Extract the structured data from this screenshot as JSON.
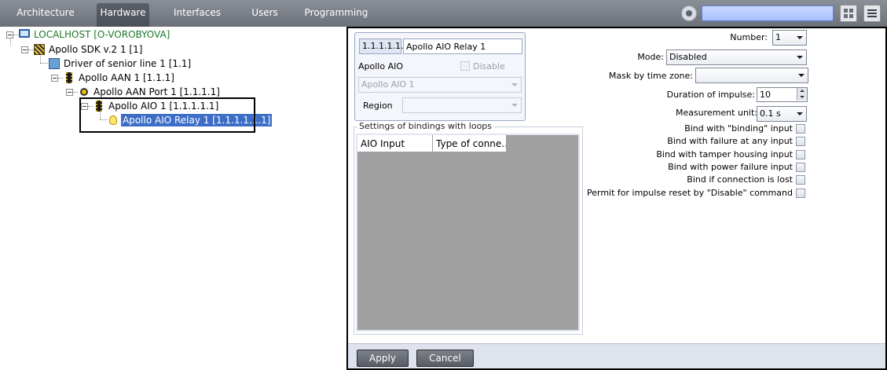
{
  "tabs": [
    {
      "label": "Architecture"
    },
    {
      "label": "Hardware"
    },
    {
      "label": "Interfaces"
    },
    {
      "label": "Users"
    },
    {
      "label": "Programming"
    }
  ],
  "active_tab": "Hardware",
  "tree": {
    "nodes": [
      {
        "label": "LOCALHOST [O-VOROBYOVA]",
        "icon": "computer-icon"
      },
      {
        "label": "Apollo SDK v.2 1 [1]",
        "icon": "sdk-icon"
      },
      {
        "label": "Driver of senior line 1 [1.1]",
        "icon": "driver-icon"
      },
      {
        "label": "Apollo AAN 1 [1.1.1]",
        "icon": "chip-icon"
      },
      {
        "label": "Apollo AAN Port 1 [1.1.1.1]",
        "icon": "port-icon"
      },
      {
        "label": "Apollo AIO 1 [1.1.1.1.1]",
        "icon": "chip-icon"
      },
      {
        "label": "Apollo AIO Relay 1 [1.1.1.1.1.1]",
        "icon": "bulb-icon"
      }
    ]
  },
  "object": {
    "number_prefix": "1.1.1.1.1.",
    "name": "Apollo AIO Relay 1",
    "parent_label": "Apollo AIO",
    "disable_label": "Disable",
    "parent_value": "Apollo AIO 1",
    "region_label": "Region",
    "region_value": ""
  },
  "bindings": {
    "title": "Settings of bindings with loops",
    "columns": [
      "AIO Input",
      "Type of conne..."
    ]
  },
  "settings": {
    "number_label": "Number:",
    "number_value": "1",
    "mode_label": "Mode:",
    "mode_value": "Disabled",
    "mask_label": "Mask by time zone:",
    "mask_value": "",
    "duration_label": "Duration of impulse:",
    "duration_value": "10",
    "unit_label": "Measurement unit:",
    "unit_value": "0.1 s",
    "checkboxes": [
      {
        "label": "Bind with \"binding\" input"
      },
      {
        "label": "Bind with failure at any input"
      },
      {
        "label": "Bind with tamper housing input"
      },
      {
        "label": "Bind with power failure input"
      },
      {
        "label": "Bind if connection is lost"
      },
      {
        "label": "Permit for impulse reset by \"Disable\" command"
      }
    ]
  },
  "footer": {
    "apply_label": "Apply",
    "cancel_label": "Cancel"
  },
  "colors": {
    "topbar": "#7a7f88",
    "selection": "#3d6ec7",
    "search": "#a8c0ff"
  }
}
